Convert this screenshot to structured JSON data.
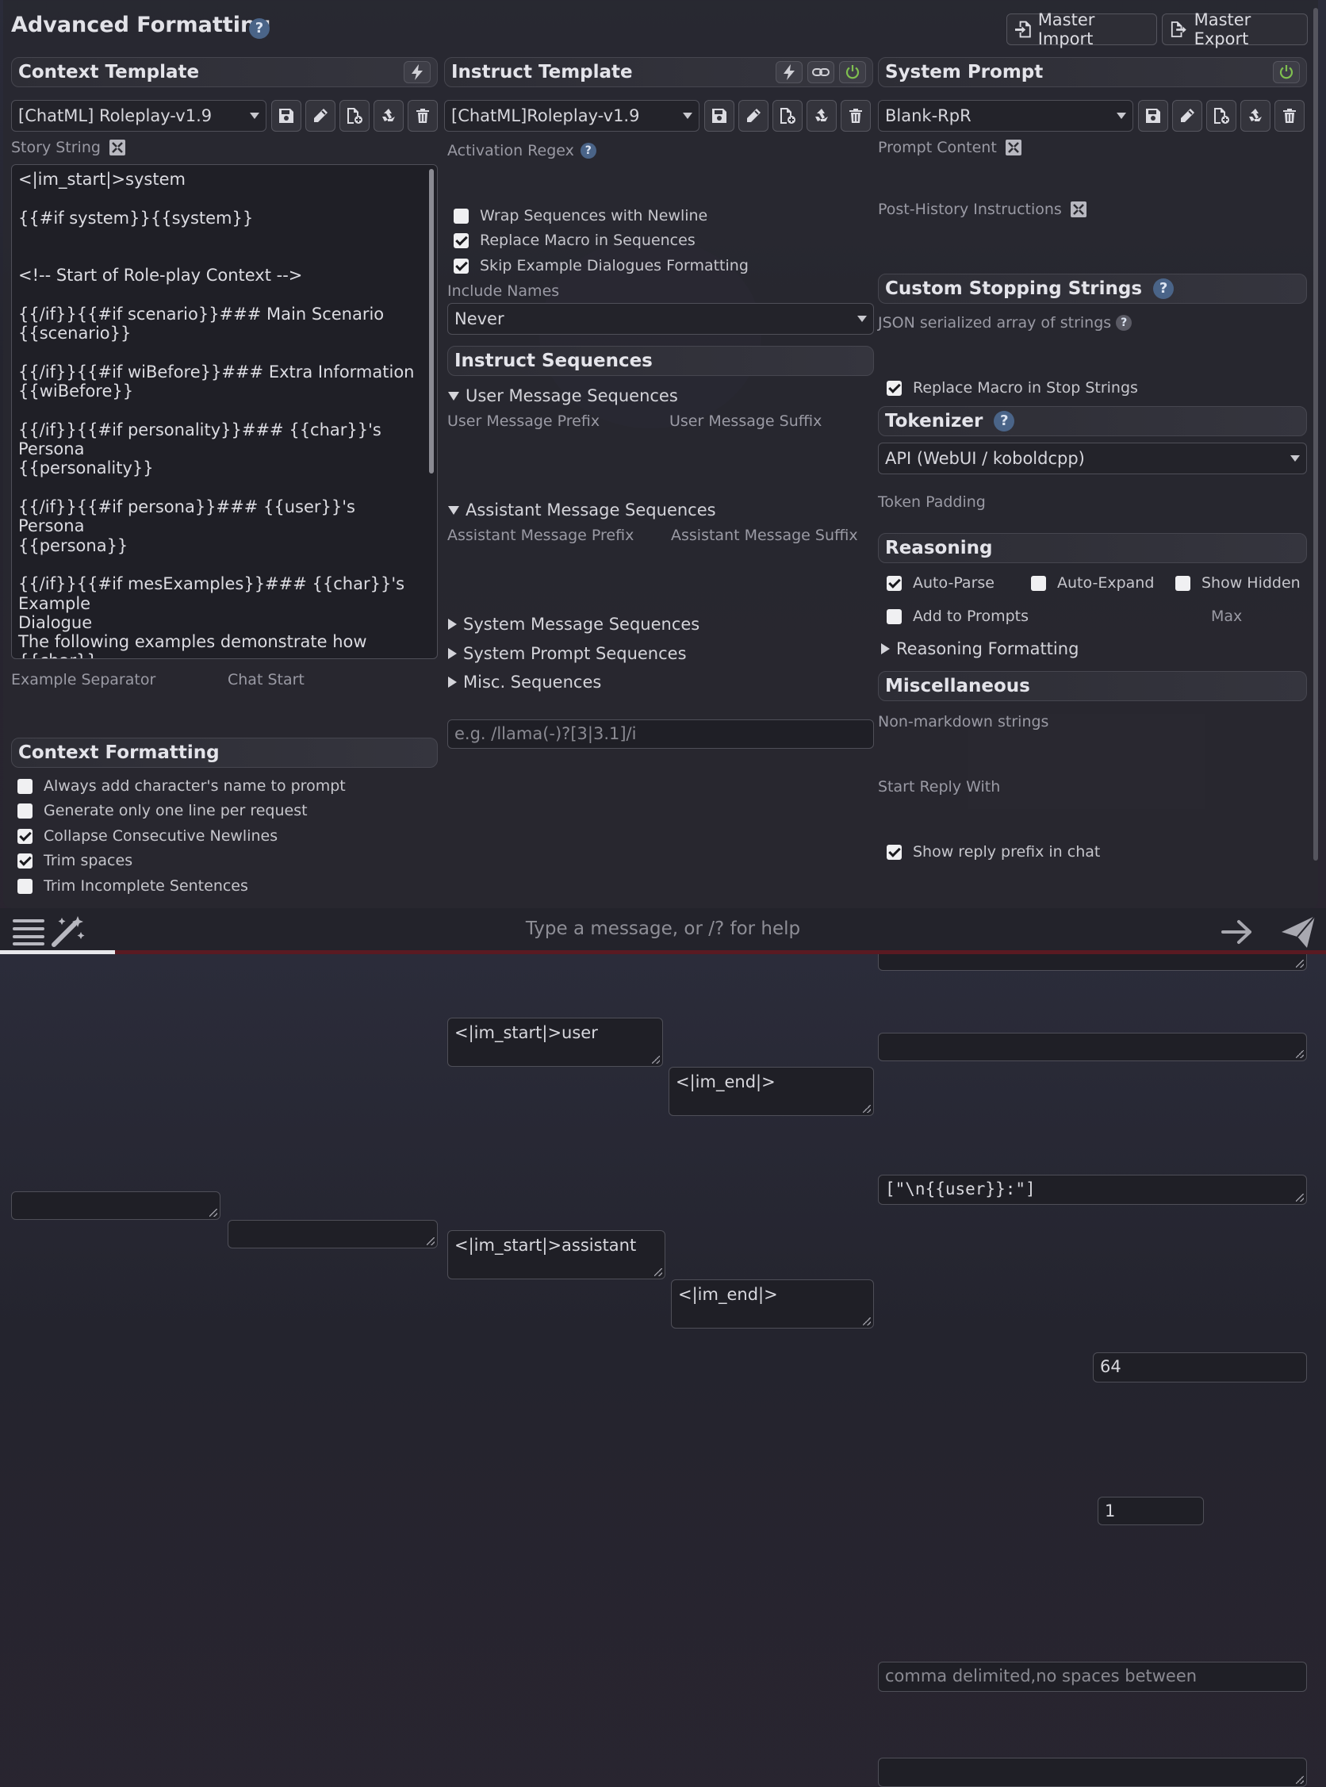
{
  "header": {
    "title": "Advanced Formatting",
    "help": "?",
    "master_import": "Master Import",
    "master_export": "Master Export"
  },
  "context": {
    "title": "Context Template",
    "preset": "[ChatML] Roleplay-v1.9",
    "story_label": "Story String",
    "story_text": "<|im_start|>system\n\n{{#if system}}{{system}}\n\n\n<!-- Start of Role-play Context -->\n\n{{/if}}{{#if scenario}}### Main Scenario\n{{scenario}}\n\n{{/if}}{{#if wiBefore}}### Extra Information\n{{wiBefore}}\n\n{{/if}}{{#if personality}}### {{char}}'s Persona\n{{personality}}\n\n{{/if}}{{#if persona}}### {{user}}'s Persona\n{{persona}}\n\n{{/if}}{{#if mesExamples}}### {{char}}'s Example\nDialogue\nThe following examples demonstrate how {{char}}\nspeaks, revealing key aspects of their personality.\nPay attention to their word choices, phrasing, and",
    "example_separator_label": "Example Separator",
    "chat_start_label": "Chat Start",
    "formatting_title": "Context Formatting",
    "options": [
      {
        "label": "Always add character's name to prompt",
        "checked": false
      },
      {
        "label": "Generate only one line per request",
        "checked": false
      },
      {
        "label": "Collapse Consecutive Newlines",
        "checked": true
      },
      {
        "label": "Trim spaces",
        "checked": true
      },
      {
        "label": "Trim Incomplete Sentences",
        "checked": false
      }
    ]
  },
  "instruct": {
    "title": "Instruct Template",
    "preset": "[ChatML]Roleplay-v1.9",
    "activation_label": "Activation Regex",
    "activation_placeholder": "e.g. /llama(-)?[3|3.1]/i",
    "options": [
      {
        "label": "Wrap Sequences with Newline",
        "checked": false
      },
      {
        "label": "Replace Macro in Sequences",
        "checked": true
      },
      {
        "label": "Skip Example Dialogues Formatting",
        "checked": true
      }
    ],
    "include_names_label": "Include Names",
    "include_names_value": "Never",
    "sequences_title": "Instruct Sequences",
    "user_group": "User Message Sequences",
    "user_prefix_label": "User Message Prefix",
    "user_suffix_label": "User Message Suffix",
    "user_prefix": "<|im_start|>user",
    "user_suffix": "<|im_end|>",
    "assistant_group": "Assistant Message Sequences",
    "assistant_prefix_label": "Assistant Message Prefix",
    "assistant_suffix_label": "Assistant Message Suffix",
    "assistant_prefix": "<|im_start|>assistant",
    "assistant_suffix": "<|im_end|>",
    "collapsed": [
      "System Message Sequences",
      "System Prompt Sequences",
      "Misc. Sequences"
    ]
  },
  "system": {
    "title": "System Prompt",
    "preset": "Blank-RpR",
    "prompt_content_label": "Prompt Content",
    "post_history_label": "Post-History Instructions",
    "stopping_title": "Custom Stopping Strings",
    "json_label": "JSON serialized array of strings",
    "stop_value": "[\"\\n{{user}}:\"]",
    "replace_macro_label": "Replace Macro in Stop Strings",
    "tokenizer_title": "Tokenizer",
    "tokenizer_value": "API (WebUI / koboldcpp)",
    "token_padding_label": "Token Padding",
    "token_padding_value": "64",
    "reasoning_title": "Reasoning",
    "auto_parse": "Auto-Parse",
    "auto_expand": "Auto-Expand",
    "show_hidden": "Show Hidden",
    "add_to_prompts": "Add to Prompts",
    "max_value": "1",
    "max_label": "Max",
    "reasoning_formatting": "Reasoning Formatting",
    "misc_title": "Miscellaneous",
    "non_markdown_label": "Non-markdown strings",
    "non_markdown_placeholder": "comma delimited,no spaces between",
    "start_reply_label": "Start Reply With",
    "show_reply_prefix": "Show reply prefix in chat"
  },
  "chat": {
    "placeholder": "Type a message, or /? for help"
  },
  "colors": {
    "accent": "#4a6488",
    "power": "#7fbf4f",
    "panel": "#28282f"
  }
}
